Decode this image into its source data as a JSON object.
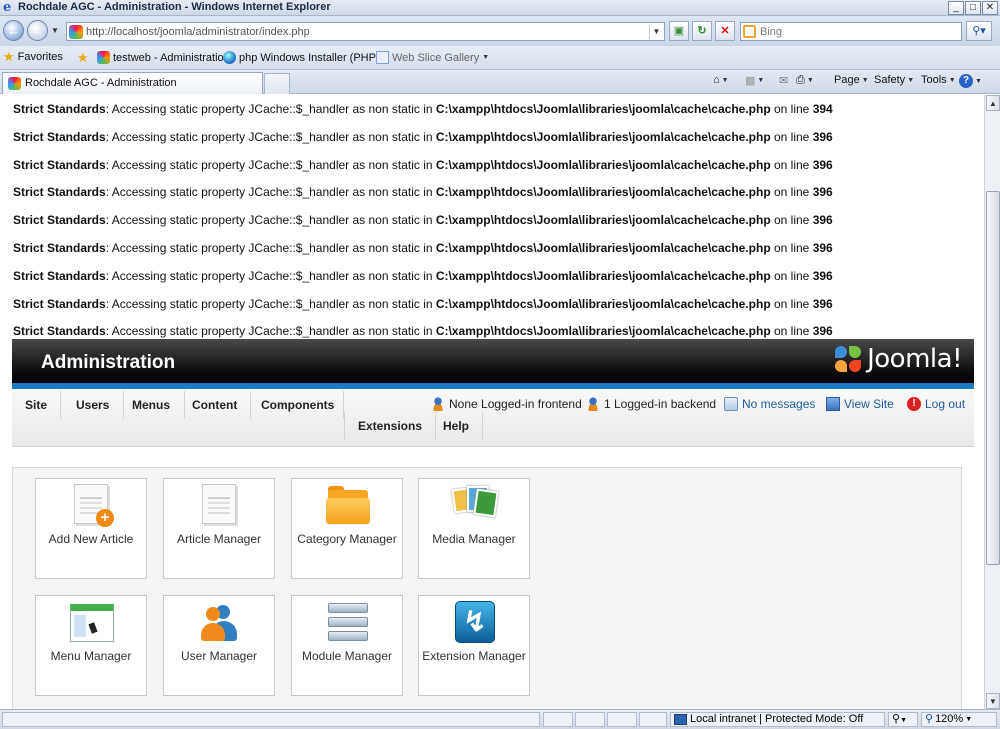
{
  "window": {
    "title": "Rochdale AGC - Administration - Windows Internet Explorer",
    "buttons": [
      "_",
      "□",
      "✕"
    ]
  },
  "address": {
    "url": "http://localhost/joomla/administrator/index.php",
    "search_placeholder": "Bing"
  },
  "favorites": {
    "label": "Favorites",
    "links": [
      "testweb - Administration",
      "php Windows Installer (PHP ...",
      "Web Slice Gallery"
    ]
  },
  "tab": {
    "title": "Rochdale AGC - Administration"
  },
  "commands": {
    "page": "Page",
    "safety": "Safety",
    "tools": "Tools"
  },
  "errors": [
    {
      "label": "Strict Standards",
      "msg": ": Accessing static property JCache::$_handler as non static in ",
      "file": "C:\\xampp\\htdocs\\Joomla\\libraries\\joomla\\cache\\cache.php",
      "on": " on line ",
      "line": "394"
    },
    {
      "label": "Strict Standards",
      "msg": ": Accessing static property JCache::$_handler as non static in ",
      "file": "C:\\xampp\\htdocs\\Joomla\\libraries\\joomla\\cache\\cache.php",
      "on": " on line ",
      "line": "396"
    },
    {
      "label": "Strict Standards",
      "msg": ": Accessing static property JCache::$_handler as non static in ",
      "file": "C:\\xampp\\htdocs\\Joomla\\libraries\\joomla\\cache\\cache.php",
      "on": " on line ",
      "line": "396"
    },
    {
      "label": "Strict Standards",
      "msg": ": Accessing static property JCache::$_handler as non static in ",
      "file": "C:\\xampp\\htdocs\\Joomla\\libraries\\joomla\\cache\\cache.php",
      "on": " on line ",
      "line": "396"
    },
    {
      "label": "Strict Standards",
      "msg": ": Accessing static property JCache::$_handler as non static in ",
      "file": "C:\\xampp\\htdocs\\Joomla\\libraries\\joomla\\cache\\cache.php",
      "on": " on line ",
      "line": "396"
    },
    {
      "label": "Strict Standards",
      "msg": ": Accessing static property JCache::$_handler as non static in ",
      "file": "C:\\xampp\\htdocs\\Joomla\\libraries\\joomla\\cache\\cache.php",
      "on": " on line ",
      "line": "396"
    },
    {
      "label": "Strict Standards",
      "msg": ": Accessing static property JCache::$_handler as non static in ",
      "file": "C:\\xampp\\htdocs\\Joomla\\libraries\\joomla\\cache\\cache.php",
      "on": " on line ",
      "line": "396"
    },
    {
      "label": "Strict Standards",
      "msg": ": Accessing static property JCache::$_handler as non static in ",
      "file": "C:\\xampp\\htdocs\\Joomla\\libraries\\joomla\\cache\\cache.php",
      "on": " on line ",
      "line": "396"
    },
    {
      "label": "Strict Standards",
      "msg": ": Accessing static property JCache::$_handler as non static in ",
      "file": "C:\\xampp\\htdocs\\Joomla\\libraries\\joomla\\cache\\cache.php",
      "on": " on line ",
      "line": "396"
    }
  ],
  "joomla": {
    "header_title": "Administration",
    "logo_text": "Joomla!",
    "menu": {
      "site": "Site",
      "users": "Users",
      "menus": "Menus",
      "content": "Content",
      "components": "Components",
      "extensions": "Extensions",
      "help": "Help"
    },
    "status": {
      "frontend": "None Logged-in frontend",
      "backend": "1 Logged-in backend",
      "messages": "No messages",
      "view_site": "View Site",
      "logout": "Log out"
    },
    "cpanel": [
      {
        "label": "Add New Article",
        "icon": "add-article-icon"
      },
      {
        "label": "Article Manager",
        "icon": "article-icon"
      },
      {
        "label": "Category Manager",
        "icon": "folder-icon"
      },
      {
        "label": "Media Manager",
        "icon": "media-icon"
      },
      {
        "label": "Menu Manager",
        "icon": "menu-window-icon"
      },
      {
        "label": "User Manager",
        "icon": "users-icon"
      },
      {
        "label": "Module Manager",
        "icon": "module-icon"
      },
      {
        "label": "Extension Manager",
        "icon": "extension-icon"
      }
    ]
  },
  "statusbar": {
    "zone": "Local intranet | Protected Mode: Off",
    "zoom": "120%"
  },
  "colors": {
    "error_text": "#111111",
    "joomla_blue": "#1b7ac2",
    "link_blue": "#1d5d9e",
    "header_black": "#0f0f0f"
  }
}
